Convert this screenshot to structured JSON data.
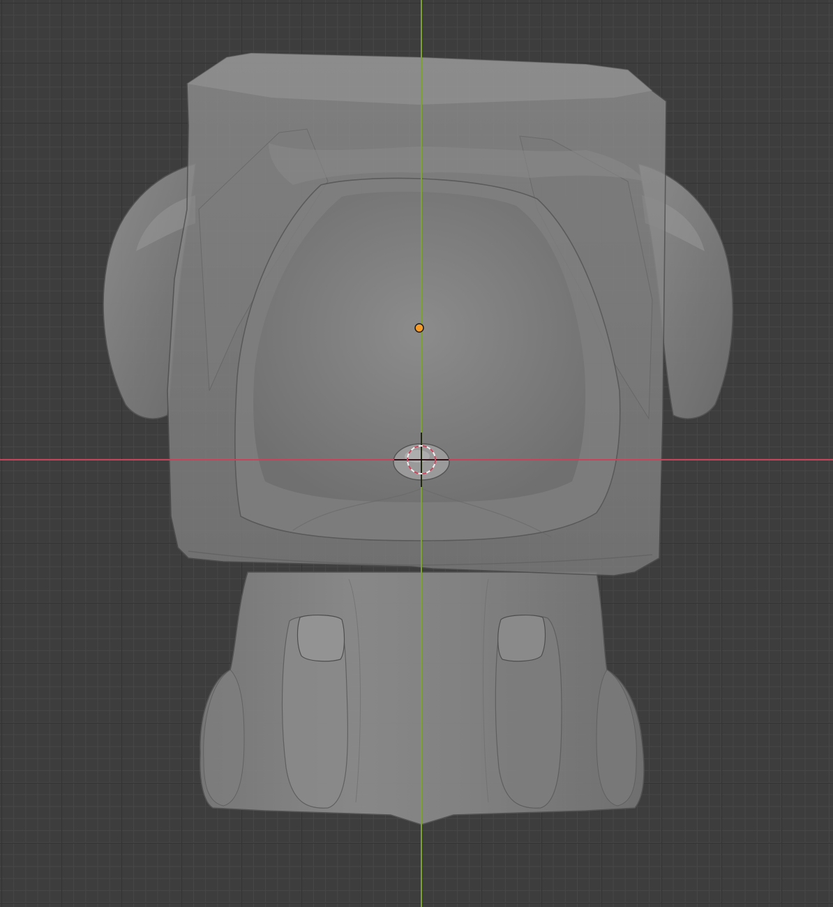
{
  "app": "3D viewport",
  "view": {
    "axis_x_color": "#c8435a",
    "axis_y_color": "#7da132",
    "background_color": "#3d3d3d",
    "grid_major_color": "#333333",
    "grid_minor_color": "#474747",
    "mesh_color": "#8a8a8a",
    "origin_color": "#f59b2a",
    "cursor_colors": [
      "#e8e8e8",
      "#c8435a"
    ]
  },
  "icons": {
    "origin": "object-origin-dot",
    "cursor": "3d-cursor"
  }
}
